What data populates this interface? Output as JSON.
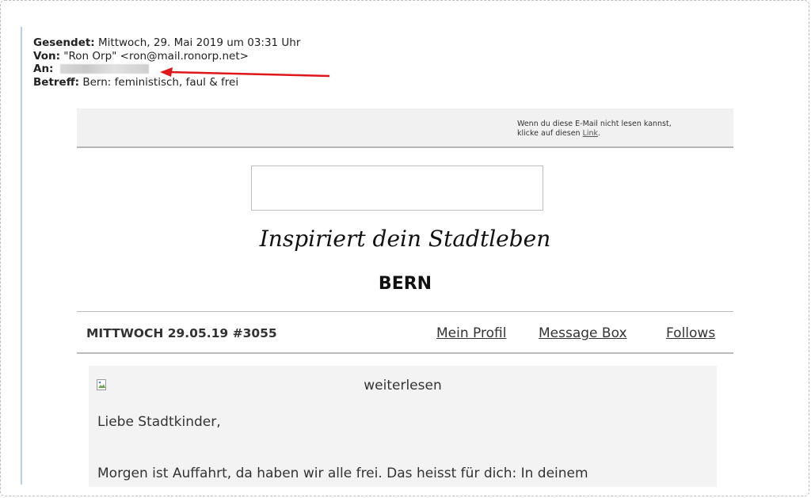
{
  "mail_header": {
    "sent_label": "Gesendet:",
    "sent_value": "Mittwoch, 29. Mai 2019 um 03:31 Uhr",
    "from_label": "Von:",
    "from_value": "\"Ron Orp\" <ron@mail.ronorp.net>",
    "to_label": "An:",
    "subject_label": "Betreff:",
    "subject_value": "Bern: feministisch, faul & frei"
  },
  "colors": {
    "arrow": "#e0161b",
    "quote_bar": "#b9cde5"
  },
  "newsletter": {
    "top_note_line1": "Wenn du diese E-Mail nicht lesen kannst,",
    "top_note_line2_prefix": "klicke auf diesen ",
    "top_note_link": "Link",
    "top_note_suffix": ".",
    "tagline": "Inspiriert dein Stadtleben",
    "city": "BERN",
    "date_issue": "MITTWOCH 29.05.19 #3055",
    "nav": {
      "profile": "Mein Profil",
      "message_box": "Message Box",
      "follows": "Follows"
    },
    "read_more": "weiterlesen",
    "greeting": "Liebe Stadtkinder,",
    "paragraph": "Morgen ist Auffahrt, da haben wir alle frei. Das heisst für dich: In deinem"
  }
}
